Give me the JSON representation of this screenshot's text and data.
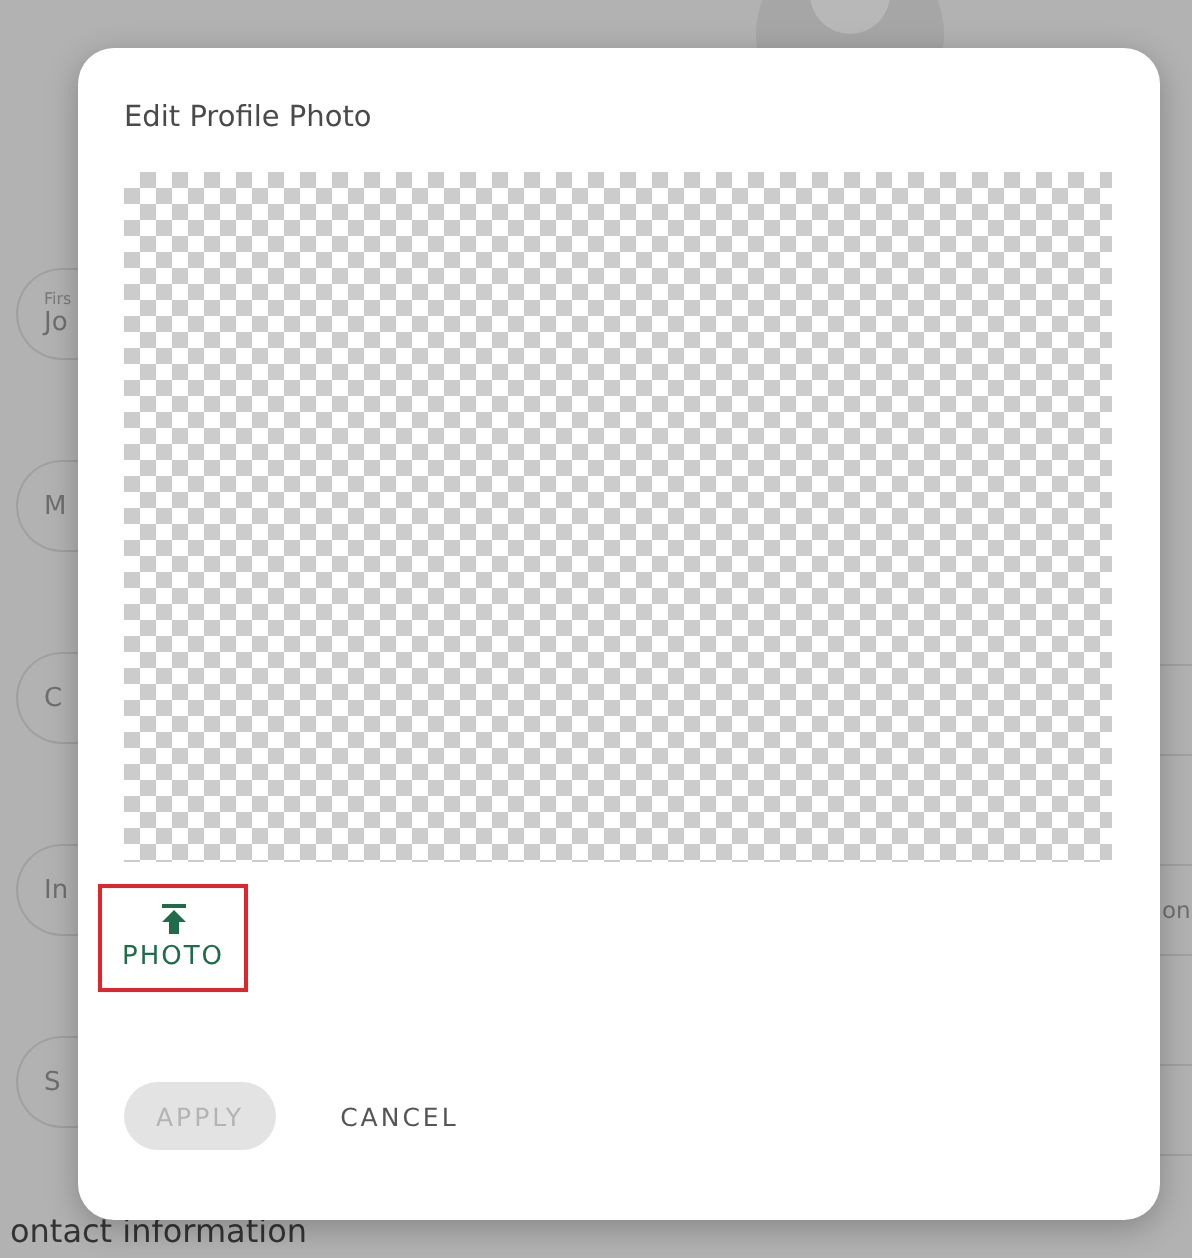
{
  "background_form": {
    "fields_left": [
      {
        "label": "Firs",
        "value": "Jo"
      },
      {
        "value": "M"
      },
      {
        "value": "C"
      },
      {
        "value": "In"
      },
      {
        "value": "S"
      }
    ],
    "fields_right": [
      {
        "kind": "blank"
      },
      {
        "kind": "text",
        "value": "on"
      },
      {
        "kind": "blank"
      }
    ],
    "section_title": "ontact information"
  },
  "dialog": {
    "title": "Edit Profile Photo",
    "upload_button": {
      "label": "PHOTO",
      "highlighted": true
    },
    "buttons": [
      {
        "label": "APPLY",
        "kind": "primary",
        "disabled": true
      },
      {
        "label": "CANCEL",
        "kind": "text",
        "disabled": false
      }
    ]
  }
}
